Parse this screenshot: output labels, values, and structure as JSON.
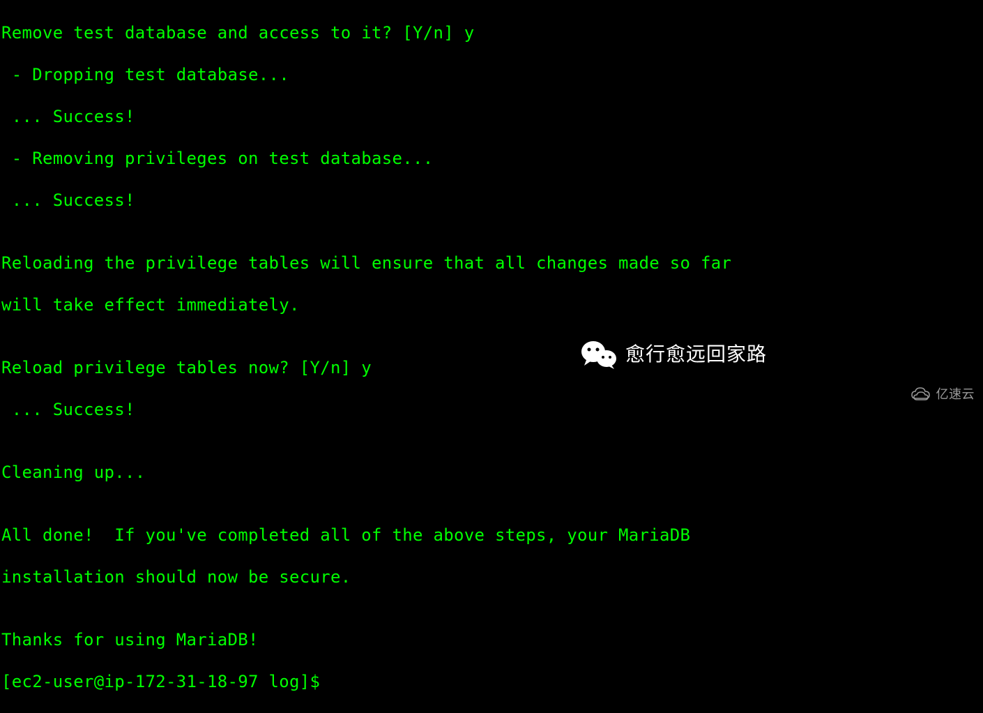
{
  "terminal": {
    "lines": [
      "Remove test database and access to it? [Y/n] y",
      " - Dropping test database...",
      " ... Success!",
      " - Removing privileges on test database...",
      " ... Success!",
      "",
      "Reloading the privilege tables will ensure that all changes made so far",
      "will take effect immediately.",
      "",
      "Reload privilege tables now? [Y/n] y",
      " ... Success!",
      "",
      "Cleaning up...",
      "",
      "All done!  If you've completed all of the above steps, your MariaDB",
      "installation should now be secure.",
      "",
      "Thanks for using MariaDB!",
      "[ec2-user@ip-172-31-18-97 log]$"
    ]
  },
  "watermarks": {
    "wechat_text": "愈行愈远回家路",
    "yisu_text": "亿速云"
  },
  "colors": {
    "background": "#000000",
    "terminal_text": "#00ff00",
    "watermark_white": "#ffffff",
    "watermark_gray": "#999999"
  }
}
